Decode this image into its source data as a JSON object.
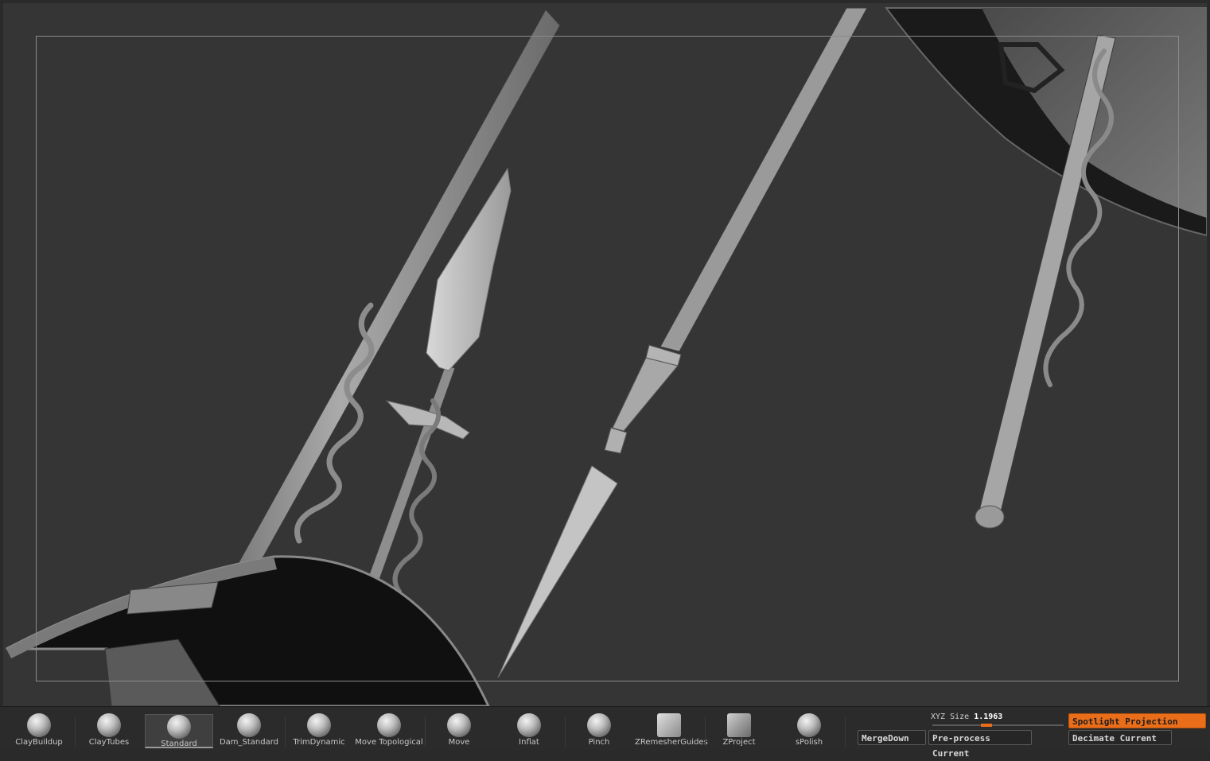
{
  "colors": {
    "accent": "#ea6d1a",
    "viewport_bg": "#353535",
    "shelf_bg": "#2b2b2b"
  },
  "brushes": [
    {
      "label": "ClayBuildup",
      "icon": "claybuildup-icon"
    },
    {
      "label": "ClayTubes",
      "icon": "claytubes-icon"
    },
    {
      "label": "Standard",
      "icon": "standard-icon",
      "active": true
    },
    {
      "label": "Dam_Standard",
      "icon": "dam-standard-icon"
    },
    {
      "label": "TrimDynamic",
      "icon": "trimdynamic-icon"
    },
    {
      "label": "Move Topological",
      "icon": "move-topological-icon"
    },
    {
      "label": "Move",
      "icon": "move-icon"
    },
    {
      "label": "Inflat",
      "icon": "inflat-icon"
    },
    {
      "label": "Pinch",
      "icon": "pinch-icon"
    },
    {
      "label": "ZRemesherGuides",
      "icon": "zremesherguides-icon"
    },
    {
      "label": "ZProject",
      "icon": "zproject-icon"
    },
    {
      "label": "sPolish",
      "icon": "spolish-icon"
    }
  ],
  "xyz_size": {
    "label": "XYZ Size",
    "value": "1.1963",
    "level": 0.38
  },
  "buttons": {
    "merge_down": "MergeDown",
    "preprocess_current": "Pre-process Current",
    "spotlight_projection": "Spotlight Projection",
    "decimate_current": "Decimate Current"
  }
}
